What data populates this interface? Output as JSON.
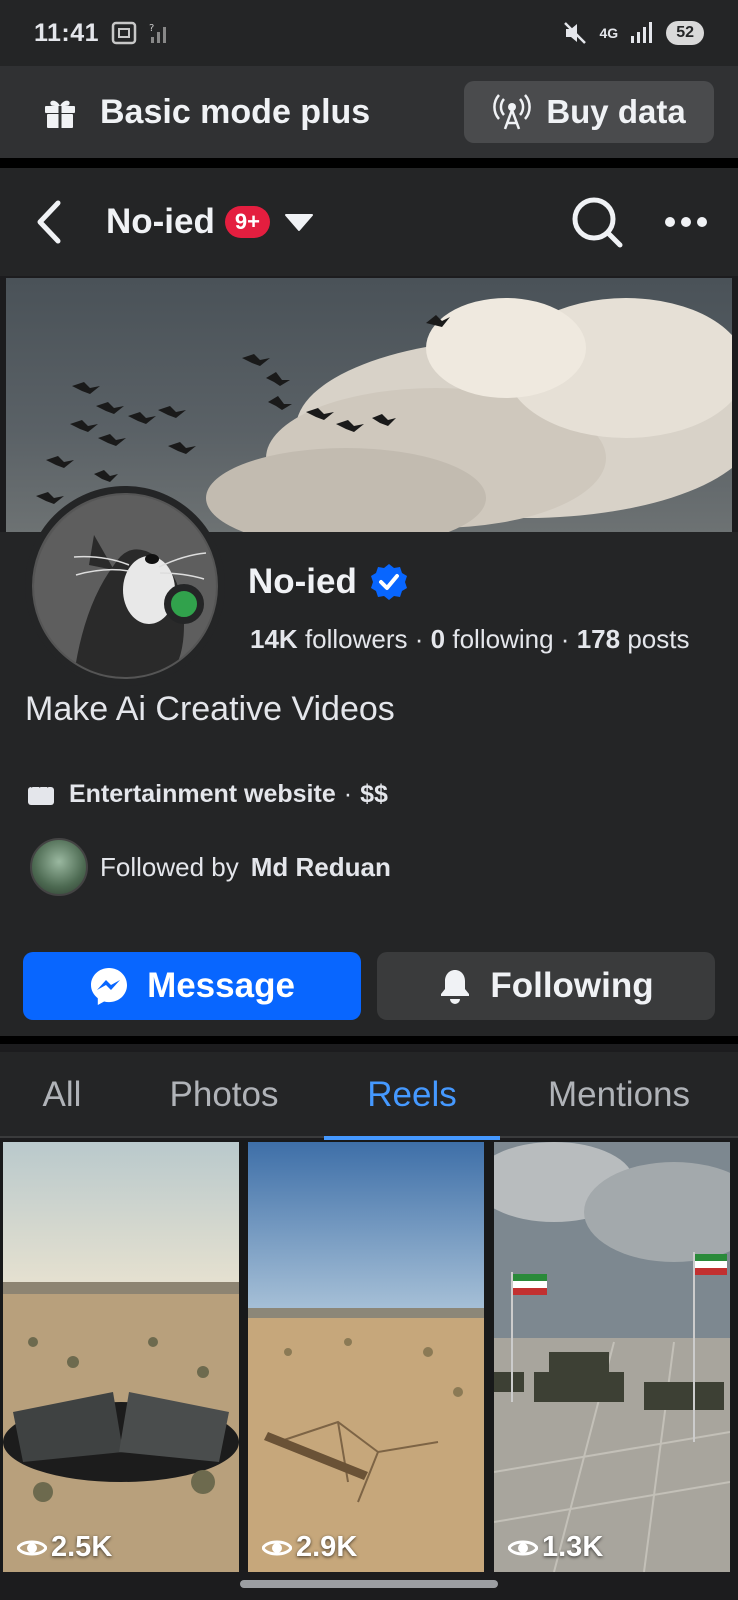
{
  "status_bar": {
    "time": "11:41",
    "network": "4G",
    "battery": "52"
  },
  "mode_bar": {
    "label": "Basic mode plus",
    "buy_data_label": "Buy data"
  },
  "header": {
    "page_name": "No-ied",
    "notification_badge": "9+"
  },
  "profile": {
    "name": "No-ied",
    "followers_count": "14K",
    "followers_label": "followers",
    "following_count": "0",
    "following_label": "following",
    "posts_count": "178",
    "posts_label": "posts",
    "separator": "·",
    "bio": "Make Ai Creative Videos",
    "category": "Entertainment website",
    "price_range": "$$",
    "followed_by_prefix": "Followed by",
    "followed_by_name": "Md Reduan"
  },
  "actions": {
    "message_label": "Message",
    "following_label": "Following"
  },
  "tabs": [
    {
      "label": "All",
      "active": false
    },
    {
      "label": "Photos",
      "active": false
    },
    {
      "label": "Reels",
      "active": true
    },
    {
      "label": "Mentions",
      "active": false
    }
  ],
  "reels": [
    {
      "views": "2.5K"
    },
    {
      "views": "2.9K"
    },
    {
      "views": "1.3K"
    }
  ],
  "colors": {
    "accent": "#0866ff",
    "tab_active": "#4599ff",
    "online": "#31a24c",
    "badge": "#e41e3f"
  }
}
